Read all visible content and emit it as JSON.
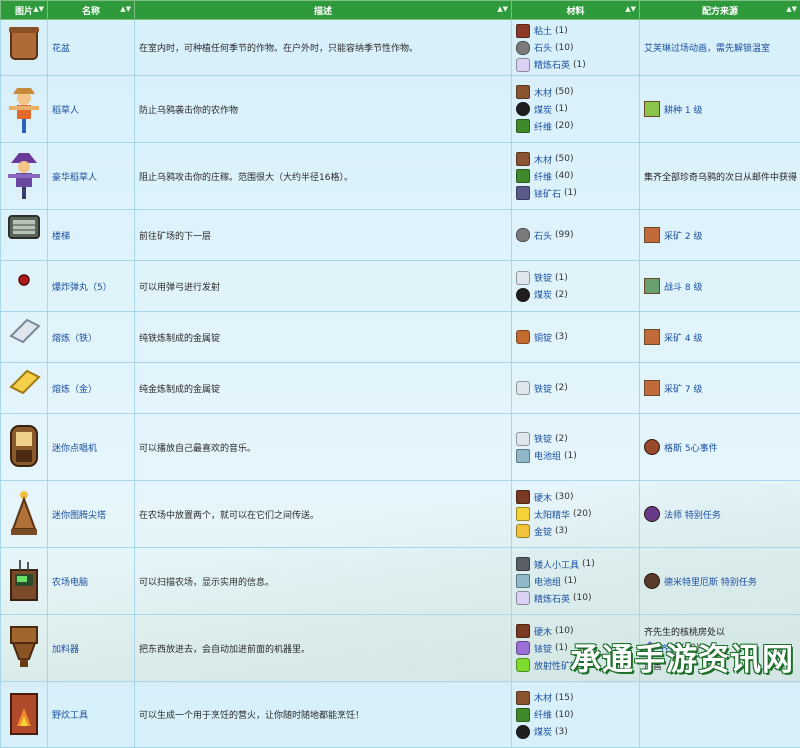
{
  "headers": {
    "image": "图片",
    "name": "名称",
    "desc": "描述",
    "materials": "材料",
    "source": "配方来源"
  },
  "rows": [
    {
      "icon": "garden-pot-icon",
      "name": "花盆",
      "desc": "在室内时，可种植任何季节的作物。在户外时，只能容纳季节性作物。",
      "materials": [
        {
          "icon": "clay-icon",
          "name": "粘土",
          "count": "(1)"
        },
        {
          "icon": "stone-icon",
          "name": "石头",
          "count": "(10)"
        },
        {
          "icon": "refined-quartz-icon",
          "name": "精炼石英",
          "count": "(1)"
        }
      ],
      "source": "艾芙琳过场动画，需先解锁温室",
      "source_icon": ""
    },
    {
      "icon": "scarecrow-icon",
      "name": "稻草人",
      "desc": "防止乌鸦袭击你的农作物",
      "materials": [
        {
          "icon": "wood-icon",
          "name": "木材",
          "count": "(50)"
        },
        {
          "icon": "coal-icon",
          "name": "煤炭",
          "count": "(1)"
        },
        {
          "icon": "fiber-icon",
          "name": "纤维",
          "count": "(20)"
        }
      ],
      "source": "耕种 1 级",
      "source_icon": "farming-skill-icon"
    },
    {
      "icon": "deluxe-scarecrow-icon",
      "name": "豪华稻草人",
      "desc": "阻止乌鸦攻击你的庄稼。范围很大（大约半径16格）。",
      "materials": [
        {
          "icon": "wood-icon",
          "name": "木材",
          "count": "(50)"
        },
        {
          "icon": "fiber-icon",
          "name": "纤维",
          "count": "(40)"
        },
        {
          "icon": "iridium-ore-icon",
          "name": "铱矿石",
          "count": "(1)"
        }
      ],
      "source": "集齐全部珍奇乌鸦的次日从邮件中获得",
      "source_icon": ""
    },
    {
      "icon": "staircase-icon",
      "name": "楼梯",
      "desc": "前往矿场的下一层",
      "materials": [
        {
          "icon": "stone-icon",
          "name": "石头",
          "count": "(99)"
        }
      ],
      "source": "采矿 2 级",
      "source_icon": "mining-skill-icon"
    },
    {
      "icon": "explosive-ammo-icon",
      "name": "爆炸弹丸（5）",
      "desc": "可以用弹弓进行发射",
      "materials": [
        {
          "icon": "iron-bar-icon",
          "name": "铁锭",
          "count": "(1)"
        },
        {
          "icon": "coal-icon",
          "name": "煤炭",
          "count": "(2)"
        }
      ],
      "source": "战斗 8 级",
      "source_icon": "combat-skill-icon"
    },
    {
      "icon": "iron-bar-icon",
      "name": "熔炼（铁）",
      "desc": "纯铁炼制成的金属锭",
      "materials": [
        {
          "icon": "copper-bar-icon",
          "name": "铜锭",
          "count": "(3)"
        }
      ],
      "source": "采矿 4 级",
      "source_icon": "mining-skill-icon"
    },
    {
      "icon": "gold-bar-icon",
      "name": "熔炼（金）",
      "desc": "纯金炼制成的金属锭",
      "materials": [
        {
          "icon": "iron-bar-icon",
          "name": "铁锭",
          "count": "(2)"
        }
      ],
      "source": "采矿 7 级",
      "source_icon": "mining-skill-icon"
    },
    {
      "icon": "mini-jukebox-icon",
      "name": "迷你点唱机",
      "desc": "可以播放自己最喜欢的音乐。",
      "materials": [
        {
          "icon": "iron-bar-icon",
          "name": "铁锭",
          "count": "(2)"
        },
        {
          "icon": "battery-pack-icon",
          "name": "电池组",
          "count": "(1)"
        }
      ],
      "source": "格斯 5心事件",
      "source_icon": "gus-portrait-icon"
    },
    {
      "icon": "mini-obelisk-icon",
      "name": "迷你图腾尖塔",
      "desc": "在农场中放置两个，就可以在它们之间传送。",
      "materials": [
        {
          "icon": "hardwood-icon",
          "name": "硬木",
          "count": "(30)"
        },
        {
          "icon": "solar-essence-icon",
          "name": "太阳精华",
          "count": "(20)"
        },
        {
          "icon": "gold-bar-icon",
          "name": "金锭",
          "count": "(3)"
        }
      ],
      "source": "法师 特别任务",
      "source_icon": "wizard-portrait-icon"
    },
    {
      "icon": "farm-computer-icon",
      "name": "农场电脑",
      "desc": "可以扫描农场，显示实用的信息。",
      "materials": [
        {
          "icon": "dwarf-gadget-icon",
          "name": "矮人小工具",
          "count": "(1)"
        },
        {
          "icon": "battery-pack-icon",
          "name": "电池组",
          "count": "(1)"
        },
        {
          "icon": "refined-quartz-icon",
          "name": "精炼石英",
          "count": "(10)"
        }
      ],
      "source": "德米特里厄斯 特别任务",
      "source_icon": "demetrius-portrait-icon"
    },
    {
      "icon": "hopper-icon",
      "name": "加料器",
      "desc": "把东西放进去，会自动加进前面的机器里。",
      "materials": [
        {
          "icon": "hardwood-icon",
          "name": "硬木",
          "count": "(10)"
        },
        {
          "icon": "iridium-bar-icon",
          "name": "铱锭",
          "count": "(1)"
        },
        {
          "icon": "radioactive-bar-icon",
          "name": "放射性矿锭",
          "count": "(1)"
        }
      ],
      "source": "齐先生的核桃房处以",
      "source_sub": {
        "icon": "qi-gem-icon",
        "name": "齐钻",
        "count": "(50)"
      },
      "source_tail": "出售",
      "source_icon": ""
    },
    {
      "icon": "cookout-kit-icon",
      "name": "野炊工具",
      "desc": "可以生成一个用于烹饪的营火，让你随时随地都能烹饪！",
      "materials": [
        {
          "icon": "wood-icon",
          "name": "木材",
          "count": "(15)"
        },
        {
          "icon": "fiber-icon",
          "name": "纤维",
          "count": "(10)"
        },
        {
          "icon": "coal-icon",
          "name": "煤炭",
          "count": "(3)"
        }
      ],
      "source": "",
      "source_icon": ""
    }
  ],
  "watermark": "承通手游资讯网",
  "colors": {
    "header": "#2f9a3c",
    "link": "#1a4fa0"
  }
}
